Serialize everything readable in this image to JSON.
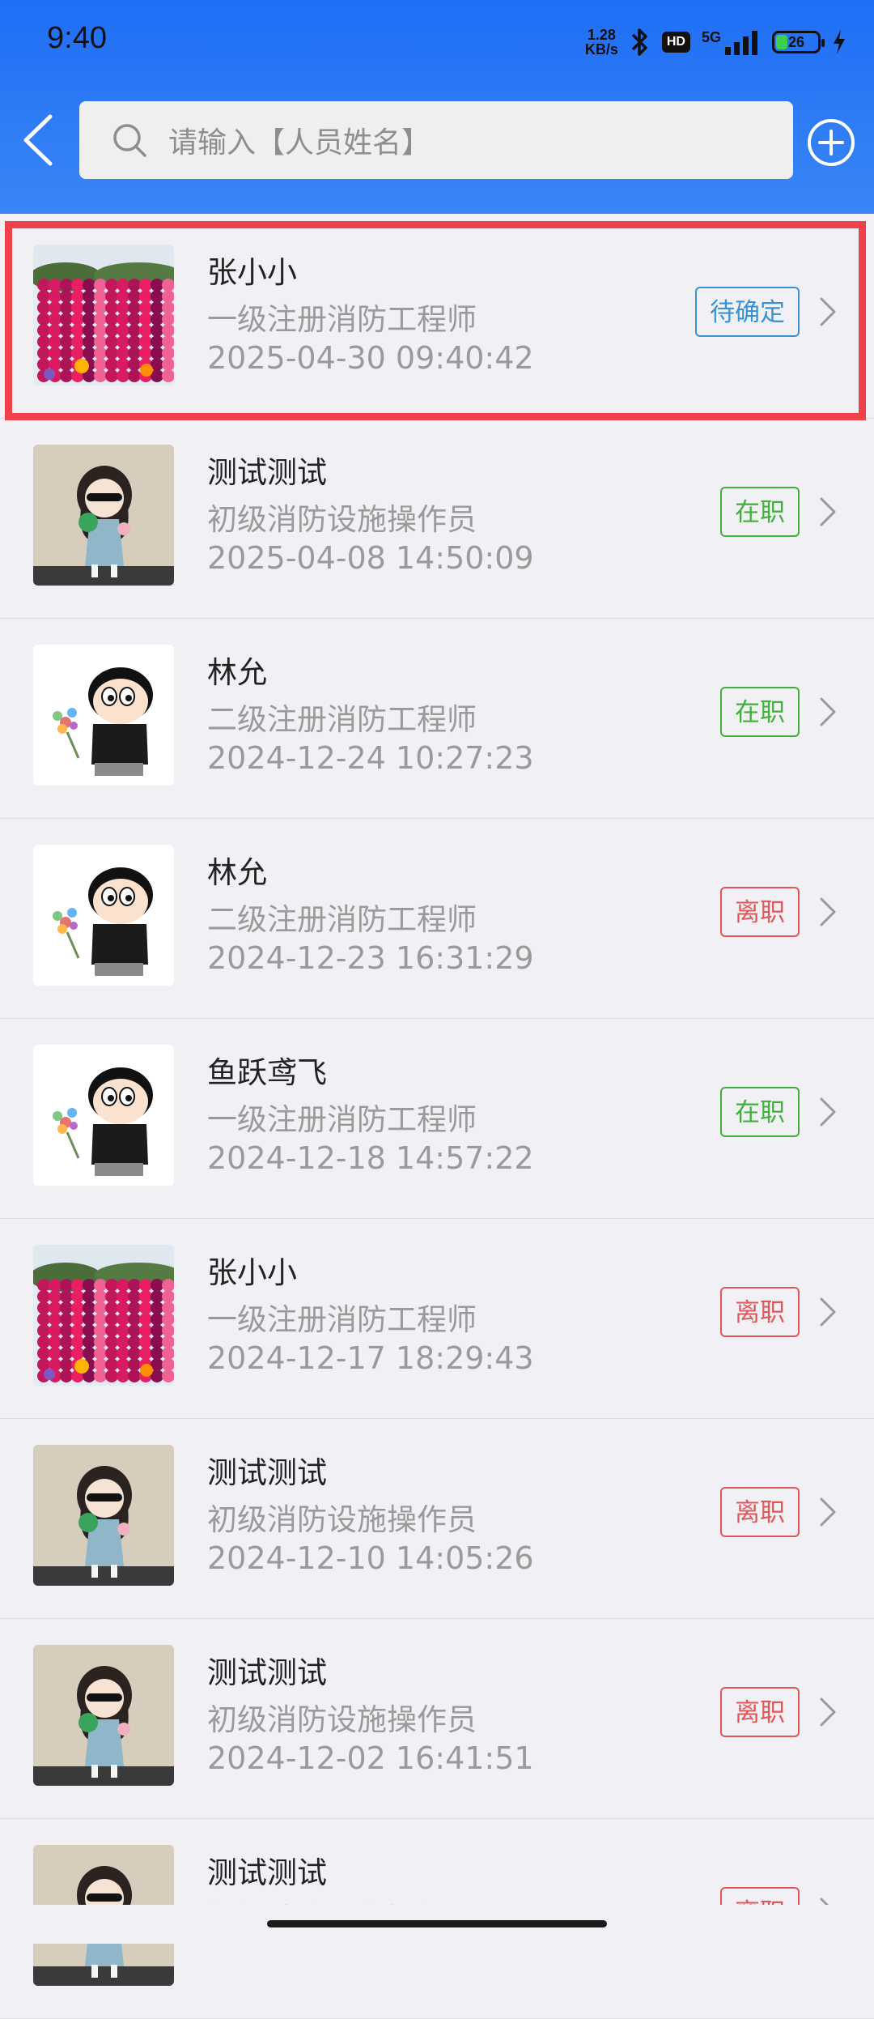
{
  "status_bar": {
    "time": "9:40",
    "net_speed_top": "1.28",
    "net_speed_bottom": "KB/s",
    "hd": "HD",
    "network": "5G",
    "battery": "26",
    "battery_level": 0.26
  },
  "search": {
    "placeholder": "请输入【人员姓名】"
  },
  "colors": {
    "header": "#1f6ef5",
    "highlight": "#f0414b",
    "pending": "#3a92d6",
    "active": "#41b03a",
    "left": "#e0575a"
  },
  "records": [
    {
      "name": "张小小",
      "role": "一级注册消防工程师",
      "date": "2025-04-30 09:40:42",
      "status": "待确定",
      "status_type": "pending",
      "avatar": "flowers"
    },
    {
      "name": "测试测试",
      "role": "初级消防设施操作员",
      "date": "2025-04-08 14:50:09",
      "status": "在职",
      "status_type": "active",
      "avatar": "girl"
    },
    {
      "name": "林允",
      "role": "二级注册消防工程师",
      "date": "2024-12-24 10:27:23",
      "status": "在职",
      "status_type": "active",
      "avatar": "cartoon-boy"
    },
    {
      "name": "林允",
      "role": "二级注册消防工程师",
      "date": "2024-12-23 16:31:29",
      "status": "离职",
      "status_type": "left",
      "avatar": "cartoon-boy"
    },
    {
      "name": "鱼跃鸢飞",
      "role": "一级注册消防工程师",
      "date": "2024-12-18 14:57:22",
      "status": "在职",
      "status_type": "active",
      "avatar": "cartoon-boy"
    },
    {
      "name": "张小小",
      "role": "一级注册消防工程师",
      "date": "2024-12-17 18:29:43",
      "status": "离职",
      "status_type": "left",
      "avatar": "flowers"
    },
    {
      "name": "测试测试",
      "role": "初级消防设施操作员",
      "date": "2024-12-10 14:05:26",
      "status": "离职",
      "status_type": "left",
      "avatar": "girl"
    },
    {
      "name": "测试测试",
      "role": "初级消防设施操作员",
      "date": "2024-12-02 16:41:51",
      "status": "离职",
      "status_type": "left",
      "avatar": "girl"
    },
    {
      "name": "测试测试",
      "role": "初级消防设施操作员",
      "date": "",
      "status": "离职",
      "status_type": "left",
      "avatar": "girl"
    }
  ]
}
